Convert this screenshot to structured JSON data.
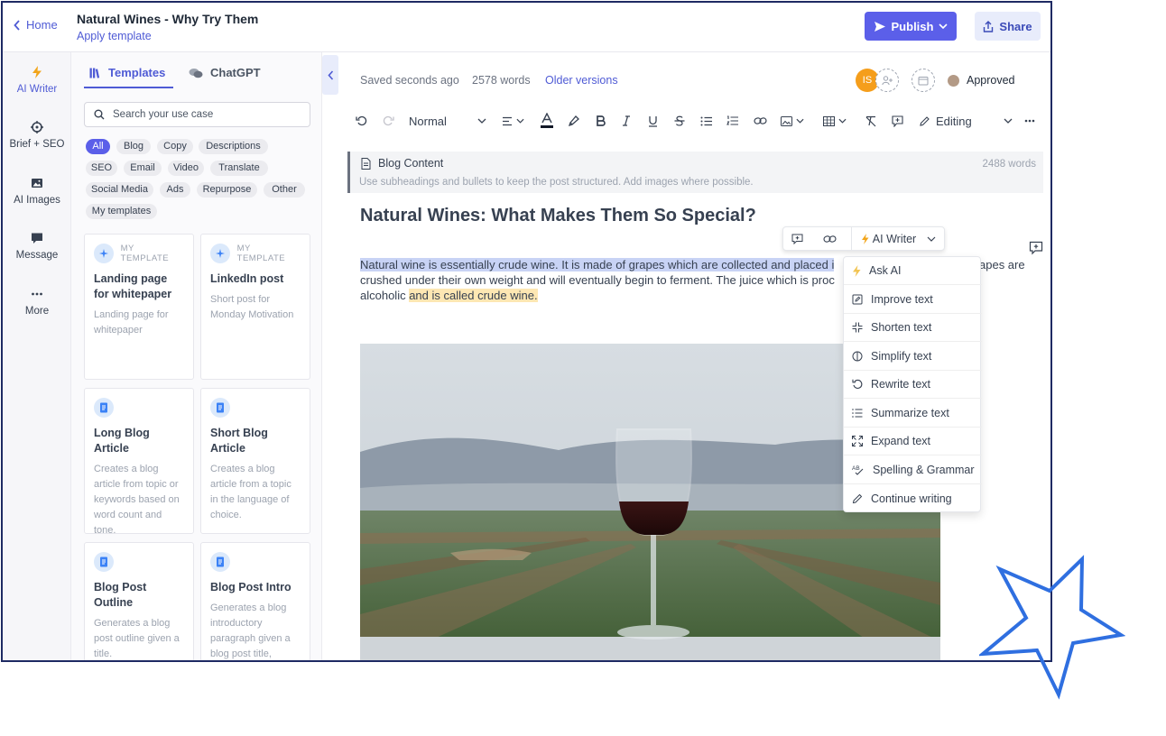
{
  "header": {
    "home_label": "Home",
    "title": "Natural Wines - Why Try Them",
    "apply_template": "Apply template",
    "publish_label": "Publish",
    "share_label": "Share",
    "publish_color": "#5b5fe9"
  },
  "rail": {
    "items": [
      {
        "label": "AI Writer",
        "icon": "lightning-icon"
      },
      {
        "label": "Brief + SEO",
        "icon": "target-icon"
      },
      {
        "label": "AI Images",
        "icon": "image-icon"
      },
      {
        "label": "Message",
        "icon": "chat-bubble-icon"
      },
      {
        "label": "More",
        "icon": "more-dots-icon"
      }
    ]
  },
  "panel": {
    "tabs": [
      "Templates",
      "ChatGPT"
    ],
    "search_placeholder": "Search your use case",
    "chips": [
      "All",
      "Blog",
      "Copy",
      "Descriptions",
      "SEO",
      "Email",
      "Video",
      "Translate",
      "Social Media",
      "Ads",
      "Repurpose",
      "Other",
      "My templates"
    ],
    "cards": [
      {
        "badge": "MY TEMPLATE",
        "title": "Landing page for whitepaper",
        "desc": "Landing page for whitepaper"
      },
      {
        "badge": "MY TEMPLATE",
        "title": "LinkedIn post",
        "desc": "Short post for Monday Motivation"
      },
      {
        "badge": "",
        "title": "Long Blog Article",
        "desc": "Creates a blog article from topic or keywords based on word count and tone."
      },
      {
        "badge": "",
        "title": "Short Blog Article",
        "desc": "Creates a blog article from a topic in the language of choice."
      },
      {
        "badge": "",
        "title": "Blog Post Outline",
        "desc": "Generates a blog post outline given a title."
      },
      {
        "badge": "",
        "title": "Blog Post Intro",
        "desc": "Generates a blog introductory paragraph given a blog post title,"
      }
    ]
  },
  "editor": {
    "status": "Saved seconds ago",
    "word_count": "2578 words",
    "older_versions": "Older versions",
    "avatar_initials": "IS",
    "approval": "Approved",
    "toolbar": {
      "style": "Normal",
      "mode": "Editing"
    },
    "note": {
      "title": "Blog Content",
      "subtitle": "Use subheadings and bullets to keep the post structured. Add images where possible.",
      "words": "2488 words"
    },
    "heading": "Natural Wines: What Makes Them So Special?",
    "paragraph": {
      "selected": "Natural wine is essentially crude wine. It is made of grapes which are collected and placed i",
      "tail": "apes are",
      "line2": "crushed under their own weight and will eventually begin to ferment. The juice which is proc",
      "line3_plain": "alcoholic ",
      "line3_highlight": "and is called crude wine."
    }
  },
  "selection_bar": {
    "ai_label": "AI Writer"
  },
  "ai_menu": {
    "items": [
      {
        "label": "Ask AI",
        "icon": "lightning-icon"
      },
      {
        "label": "Improve text",
        "icon": "edit-box-icon"
      },
      {
        "label": "Shorten text",
        "icon": "shrink-icon"
      },
      {
        "label": "Simplify text",
        "icon": "simplify-icon"
      },
      {
        "label": "Rewrite text",
        "icon": "rewrite-icon"
      },
      {
        "label": "Summarize text",
        "icon": "list-icon"
      },
      {
        "label": "Expand text",
        "icon": "expand-icon"
      },
      {
        "label": "Spelling & Grammar",
        "icon": "spellcheck-icon"
      },
      {
        "label": "Continue writing",
        "icon": "pencil-icon"
      }
    ]
  },
  "colors": {
    "accent": "#4f5bd5",
    "active_chip": "#5b5fe9",
    "avatar": "#f59e1b",
    "star": "#2f6fe0"
  }
}
